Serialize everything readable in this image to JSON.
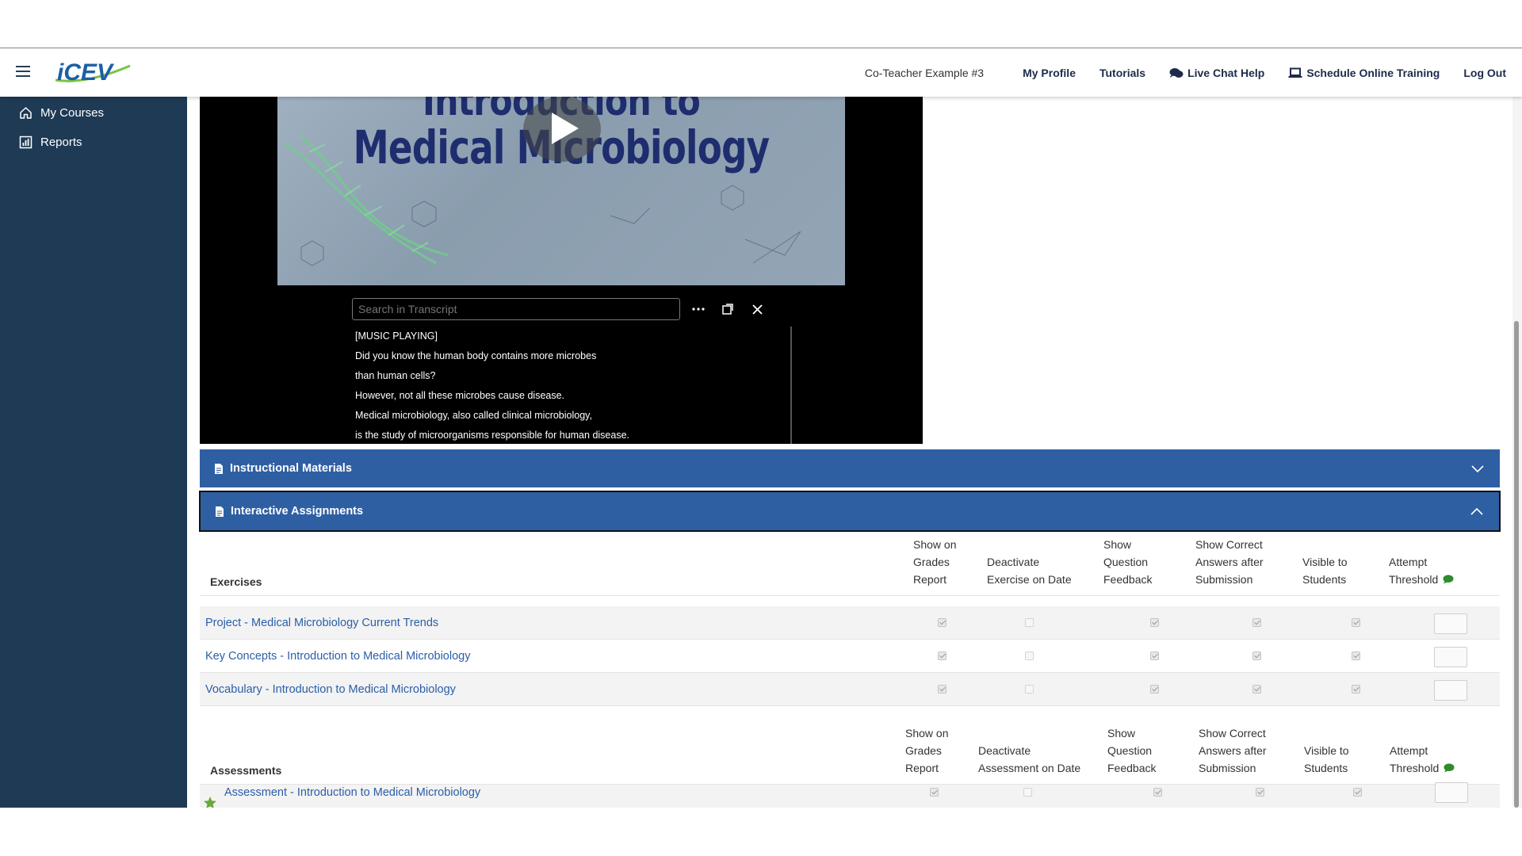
{
  "header": {
    "logo_text": "iCEV",
    "user_name": "Co-Teacher Example #3",
    "my_profile": "My Profile",
    "tutorials": "Tutorials",
    "live_chat": "Live Chat Help",
    "schedule_training": "Schedule Online Training",
    "logout": "Log Out"
  },
  "sidebar": {
    "items": [
      {
        "label": "My Courses",
        "icon": "home-icon"
      },
      {
        "label": "Reports",
        "icon": "chart-icon"
      }
    ]
  },
  "video": {
    "title_line1": "Introduction to",
    "title_line2": "Medical Microbiology",
    "search_placeholder": "Search in Transcript",
    "transcript": [
      "[MUSIC PLAYING]",
      "Did you know the human body contains more microbes",
      "than human cells?",
      "However, not all these microbes cause disease.",
      "Medical microbiology, also called clinical microbiology,",
      "is the study of microorganisms responsible for human disease."
    ]
  },
  "panels": {
    "materials": "Instructional Materials",
    "interactive": "Interactive Assignments"
  },
  "exercises": {
    "title": "Exercises",
    "columns": [
      "Show on Grades Report",
      "Deactivate Exercise on Date",
      "Show Question Feedback",
      "Show Correct Answers after Submission",
      "Visible to Students",
      "Attempt Threshold"
    ],
    "rows": [
      {
        "name": "Project - Medical Microbiology Current Trends",
        "grades": true,
        "deactivate": false,
        "feedback": true,
        "correct": true,
        "visible": true,
        "threshold": ""
      },
      {
        "name": "Key Concepts - Introduction to Medical Microbiology",
        "grades": true,
        "deactivate": false,
        "feedback": true,
        "correct": true,
        "visible": true,
        "threshold": ""
      },
      {
        "name": "Vocabulary - Introduction to Medical Microbiology",
        "grades": true,
        "deactivate": false,
        "feedback": true,
        "correct": true,
        "visible": true,
        "threshold": ""
      }
    ]
  },
  "assessments": {
    "title": "Assessments",
    "columns": [
      "Show on Grades Report",
      "Deactivate Assessment on Date",
      "Show Question Feedback",
      "Show Correct Answers after Submission",
      "Visible to Students",
      "Attempt Threshold"
    ],
    "rows": [
      {
        "name": "Assessment - Introduction to Medical Microbiology",
        "starred": true,
        "grades": true,
        "deactivate": false,
        "feedback": true,
        "correct": true,
        "visible": true,
        "threshold": ""
      }
    ]
  },
  "colors": {
    "sidebar": "#1e3a55",
    "panel": "#2f5fa3",
    "link": "#2a5ea8",
    "chat_icon": "#2e8b2e",
    "star": "#6aa83a"
  }
}
